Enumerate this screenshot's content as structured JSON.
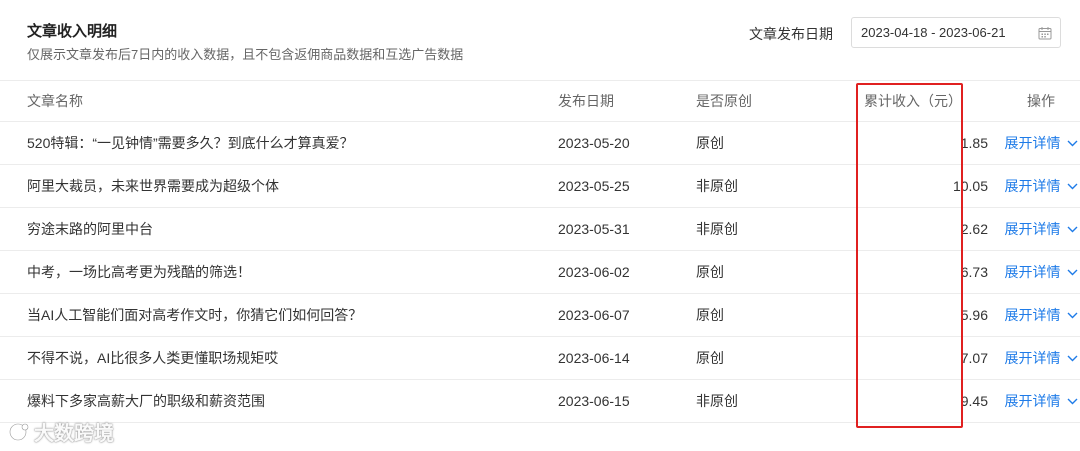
{
  "header": {
    "title": "文章收入明细",
    "subtitle": "仅展示文章发布后7日内的收入数据，且不包含返佣商品数据和互选广告数据",
    "date_label": "文章发布日期",
    "date_range": "2023-04-18 - 2023-06-21",
    "date_icon": "calendar-icon"
  },
  "table": {
    "columns": [
      "文章名称",
      "发布日期",
      "是否原创",
      "累计收入（元）",
      "操作"
    ],
    "rows": [
      {
        "name": "520特辑：“一见钟情”需要多久？到底什么才算真爱？",
        "date": "2023-05-20",
        "original": "原创",
        "income": "1.85",
        "action": "展开详情"
      },
      {
        "name": "阿里大裁员，未来世界需要成为超级个体",
        "date": "2023-05-25",
        "original": "非原创",
        "income": "10.05",
        "action": "展开详情"
      },
      {
        "name": "穷途末路的阿里中台",
        "date": "2023-05-31",
        "original": "非原创",
        "income": "2.62",
        "action": "展开详情"
      },
      {
        "name": "中考，一场比高考更为残酷的筛选！",
        "date": "2023-06-02",
        "original": "原创",
        "income": "6.73",
        "action": "展开详情"
      },
      {
        "name": "当AI人工智能们面对高考作文时，你猜它们如何回答？",
        "date": "2023-06-07",
        "original": "原创",
        "income": "5.96",
        "action": "展开详情"
      },
      {
        "name": "不得不说，AI比很多人类更懂职场规矩哎",
        "date": "2023-06-14",
        "original": "原创",
        "income": "7.07",
        "action": "展开详情"
      },
      {
        "name": "爆料下多家高薪大厂的职级和薪资范围",
        "date": "2023-06-15",
        "original": "非原创",
        "income": "9.45",
        "action": "展开详情"
      }
    ]
  },
  "colors": {
    "link": "#1e7be8",
    "highlight": "#e02020",
    "border": "#ececec"
  },
  "watermark": {
    "text": "大数跨境"
  }
}
